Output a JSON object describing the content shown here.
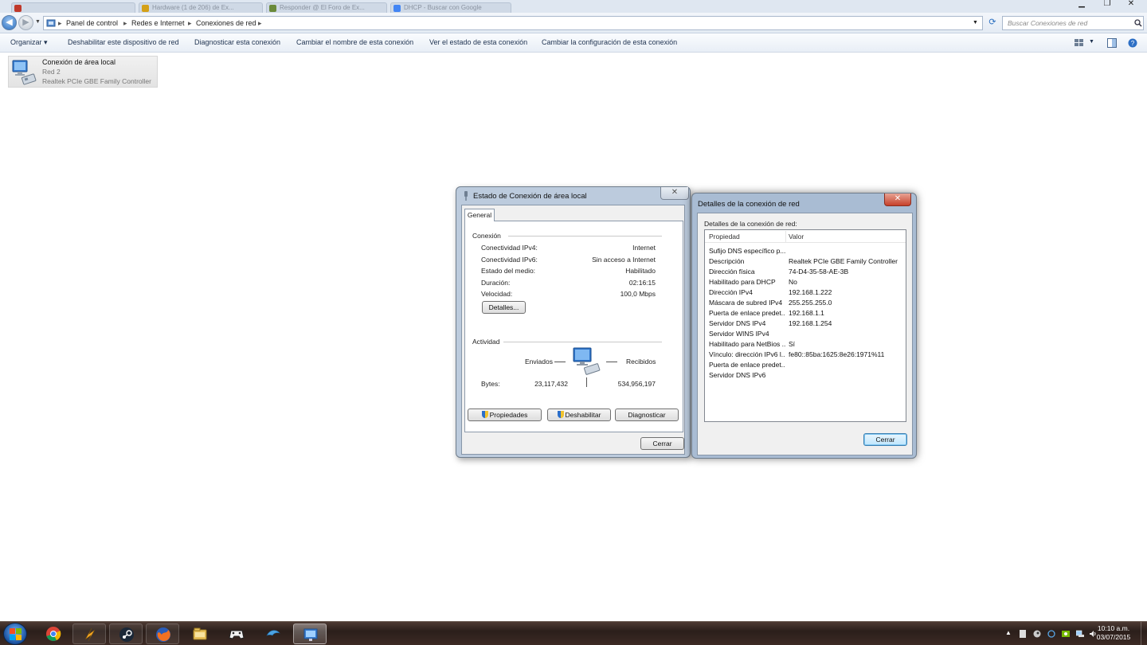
{
  "browser_tabs": [
    {
      "title": "",
      "color": "#c0392b"
    },
    {
      "title": "Hardware (1 de 206) de Ex...",
      "color": "#d4a017"
    },
    {
      "title": "Responder @ El Foro de Ex...",
      "color": "#6a8a3a"
    },
    {
      "title": "DHCP - Buscar con Google",
      "color": "#4285f4"
    }
  ],
  "window_controls": {
    "minimize": "▁",
    "maximize": "❐",
    "close": "✕"
  },
  "explorer": {
    "breadcrumb": [
      "Panel de control",
      "Redes e Internet",
      "Conexiones de red"
    ],
    "search_placeholder": "Buscar Conexiones de red",
    "commands": [
      "Organizar ▾",
      "Deshabilitar este dispositivo de red",
      "Diagnosticar esta conexión",
      "Cambiar el nombre de esta conexión",
      "Ver el estado de esta conexión",
      "Cambiar la configuración de esta conexión"
    ],
    "connection": {
      "name": "Conexión de área local",
      "network": "Red  2",
      "adapter": "Realtek PCIe GBE Family Controller"
    }
  },
  "status_dialog": {
    "title": "Estado de Conexión de área local",
    "tab": "General",
    "connection_group": "Conexión",
    "rows": [
      {
        "label": "Conectividad IPv4:",
        "value": "Internet"
      },
      {
        "label": "Conectividad IPv6:",
        "value": "Sin acceso a Internet"
      },
      {
        "label": "Estado del medio:",
        "value": "Habilitado"
      },
      {
        "label": "Duración:",
        "value": "02:16:15"
      },
      {
        "label": "Velocidad:",
        "value": "100,0 Mbps"
      }
    ],
    "details_button": "Detalles...",
    "activity_group": "Actividad",
    "sent_label": "Enviados",
    "received_label": "Recibidos",
    "bytes_label": "Bytes:",
    "bytes_sent": "23,117,432",
    "bytes_received": "534,956,197",
    "buttons": {
      "properties": "Propiedades",
      "disable": "Deshabilitar",
      "diagnose": "Diagnosticar",
      "close": "Cerrar"
    }
  },
  "details_dialog": {
    "title": "Detalles de la conexión de red",
    "subtitle": "Detalles de la conexión de red:",
    "col_property": "Propiedad",
    "col_value": "Valor",
    "rows": [
      {
        "property": "Sufijo DNS específico p...",
        "value": ""
      },
      {
        "property": "Descripción",
        "value": "Realtek PCIe GBE Family Controller"
      },
      {
        "property": "Dirección física",
        "value": "74-D4-35-58-AE-3B"
      },
      {
        "property": "Habilitado para DHCP",
        "value": "No"
      },
      {
        "property": "Dirección IPv4",
        "value": "192.168.1.222"
      },
      {
        "property": "Máscara de subred IPv4",
        "value": "255.255.255.0"
      },
      {
        "property": "Puerta de enlace predet...",
        "value": "192.168.1.1"
      },
      {
        "property": "Servidor DNS IPv4",
        "value": "192.168.1.254"
      },
      {
        "property": "Servidor WINS IPv4",
        "value": ""
      },
      {
        "property": "Habilitado para NetBios ...",
        "value": "Sí"
      },
      {
        "property": "Vínculo: dirección IPv6 l...",
        "value": "fe80::85ba:1625:8e26:1971%11"
      },
      {
        "property": "Puerta de enlace predet...",
        "value": ""
      },
      {
        "property": "Servidor DNS IPv6",
        "value": ""
      }
    ],
    "close_button": "Cerrar"
  },
  "taskbar": {
    "apps": [
      "chrome-icon",
      "winamp-icon",
      "steam-icon",
      "firefox-icon",
      "explorer-folder-icon",
      "game-controller-icon",
      "dolphin-icon",
      "network-connections-icon"
    ],
    "time": "10:10 a.m.",
    "date": "03/07/2015"
  }
}
